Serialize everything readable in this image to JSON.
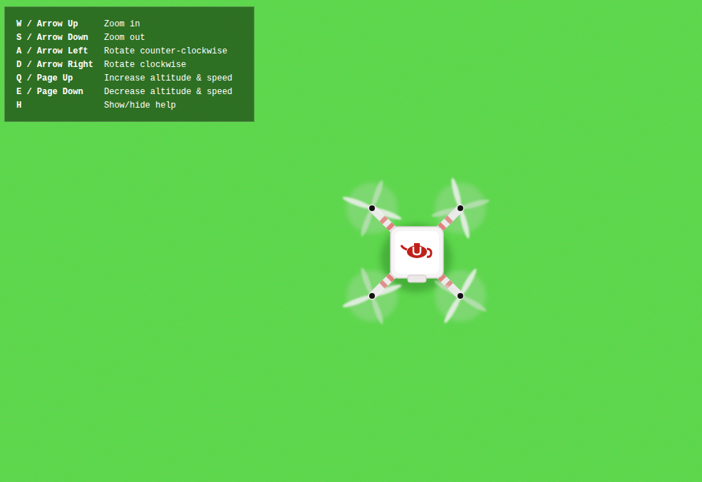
{
  "help": {
    "visible": true,
    "shortcuts": [
      {
        "key": "W / Arrow Up",
        "action": "Zoom in"
      },
      {
        "key": "S / Arrow Down",
        "action": "Zoom out"
      },
      {
        "key": "A / Arrow Left",
        "action": "Rotate counter-clockwise"
      },
      {
        "key": "D / Arrow Right",
        "action": "Rotate clockwise"
      },
      {
        "key": "Q / Page Up",
        "action": "Increase altitude & speed"
      },
      {
        "key": "E / Page Down",
        "action": "Decrease altitude & speed"
      },
      {
        "key": "H",
        "action": "Show/hide help"
      }
    ]
  }
}
